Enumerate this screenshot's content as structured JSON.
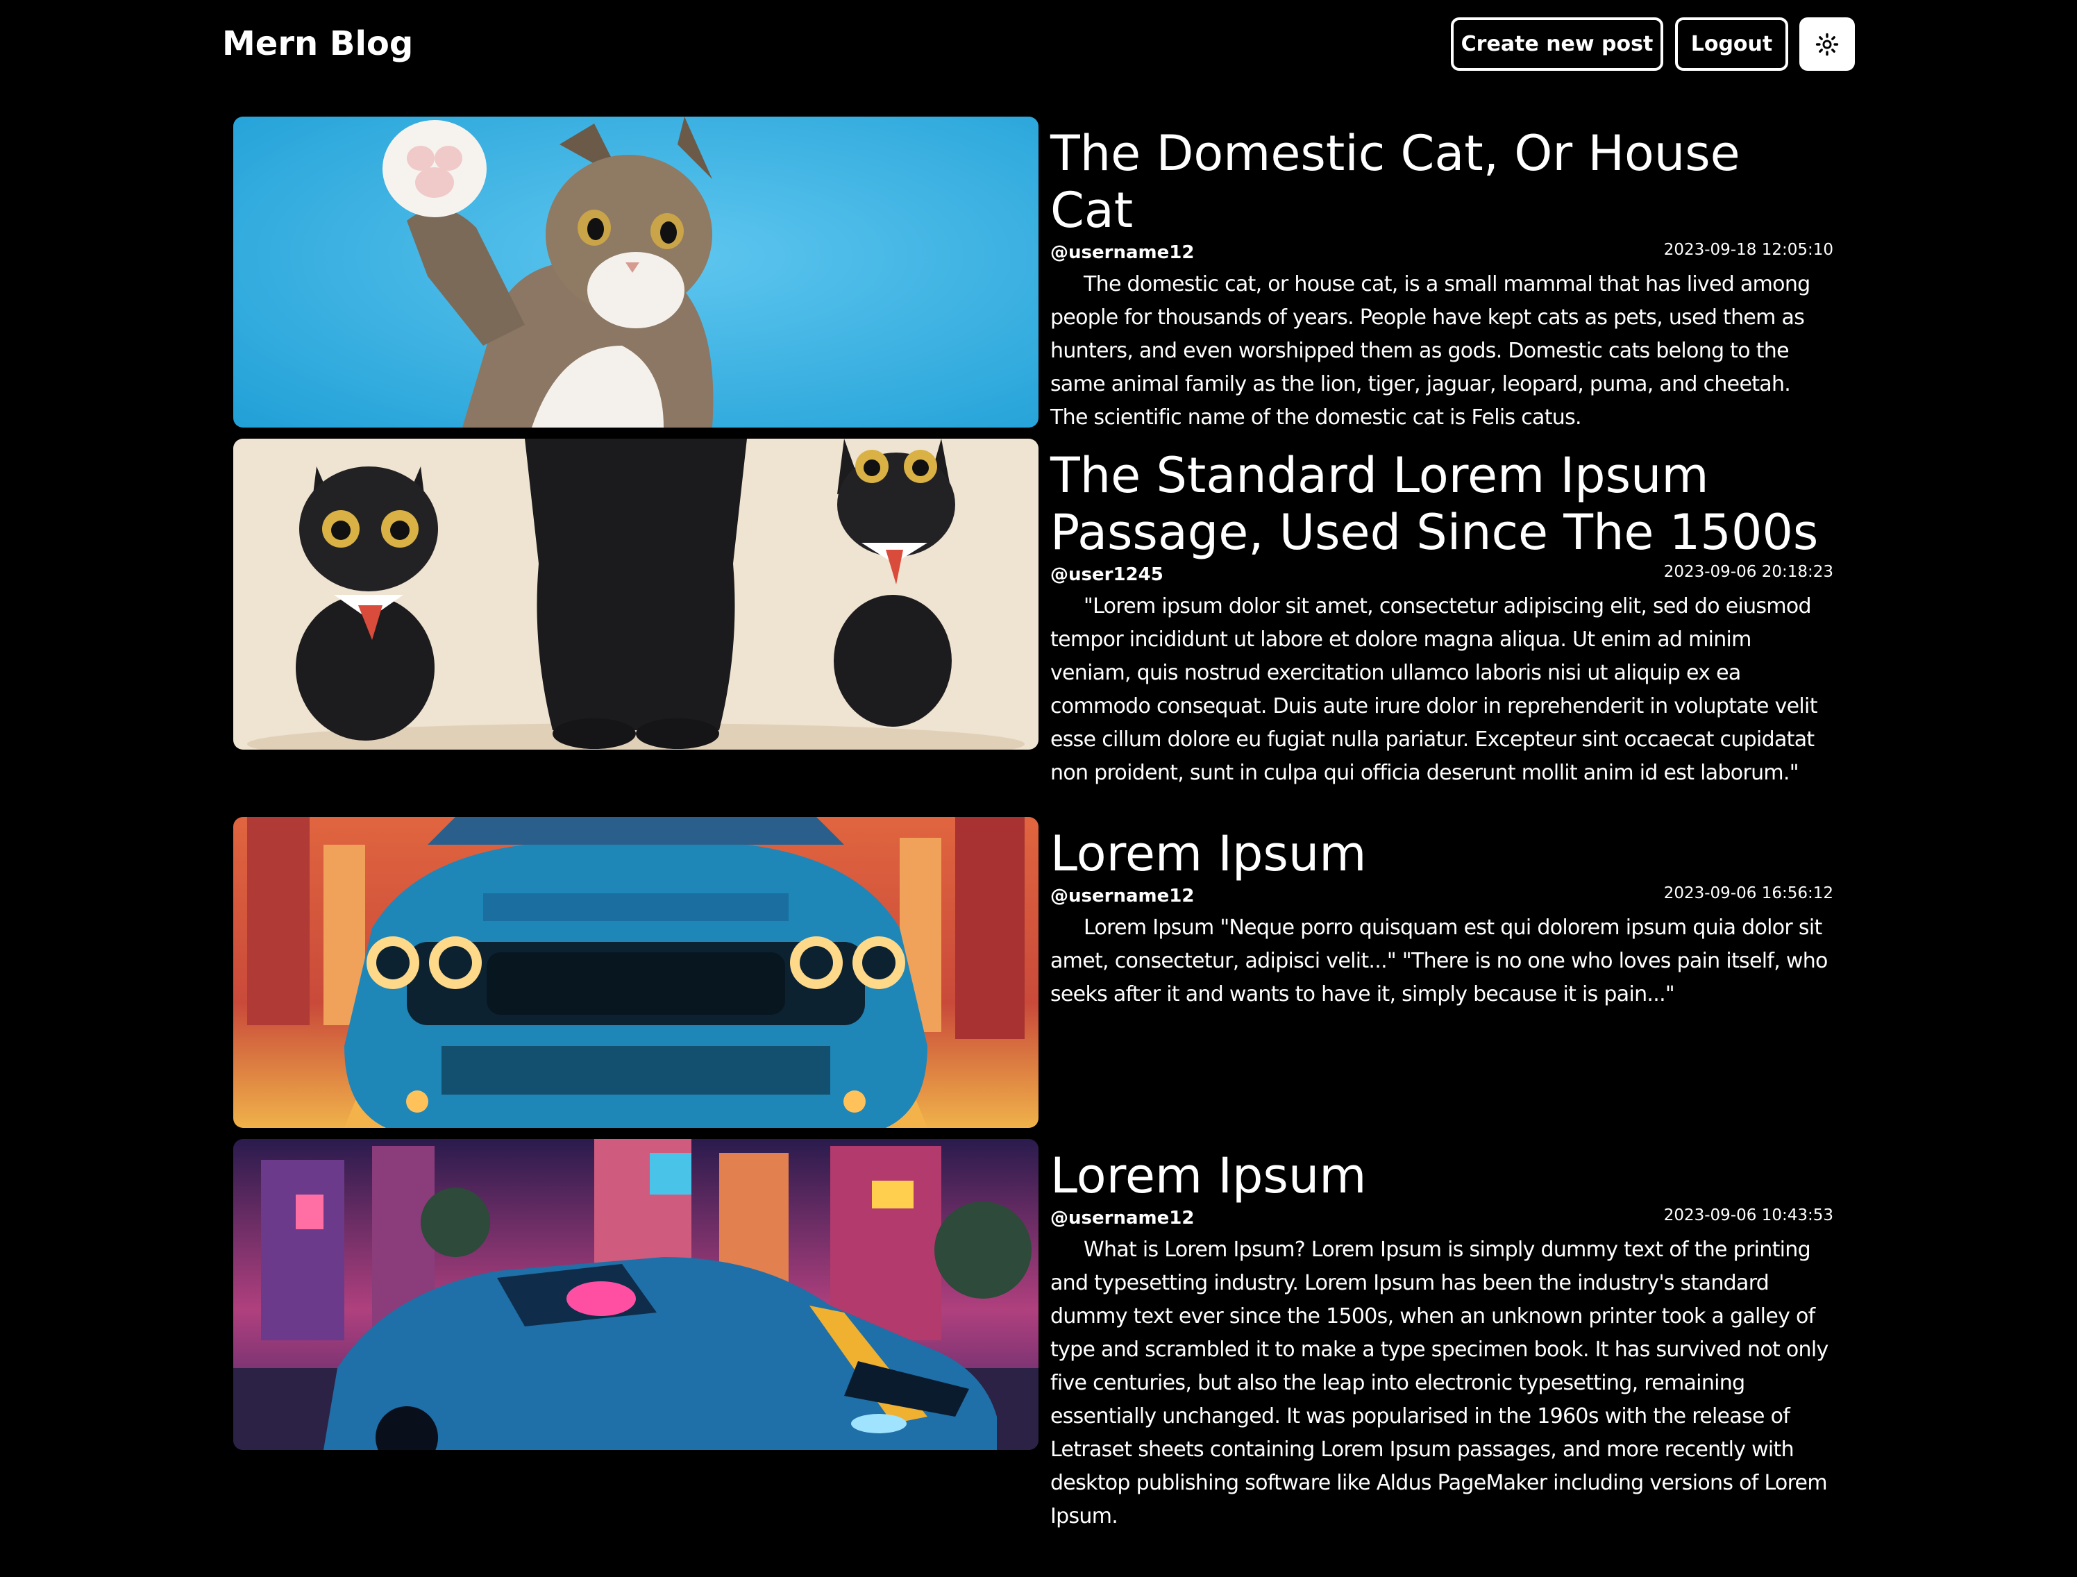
{
  "header": {
    "brand": "Mern Blog",
    "create_label": "Create new post",
    "logout_label": "Logout",
    "theme_icon": "sun-icon"
  },
  "posts": [
    {
      "title": "The Domestic Cat, Or House Cat",
      "author": "@username12",
      "time": "2023-09-18 12:05:10",
      "summary": "The domestic cat, or house cat, is a small mammal that has lived among people for thousands of years. People have kept cats as pets, used them as hunters, and even worshipped them as gods. Domestic cats belong to the same animal family as the lion, tiger, jaguar, leopard, puma, and cheetah. The scientific name of the domestic cat is Felis catus."
    },
    {
      "title": "The Standard Lorem Ipsum Passage, Used Since The 1500s",
      "author": "@user1245",
      "time": "2023-09-06 20:18:23",
      "summary": "\"Lorem ipsum dolor sit amet, consectetur adipiscing elit, sed do eiusmod tempor incididunt ut labore et dolore magna aliqua. Ut enim ad minim veniam, quis nostrud exercitation ullamco laboris nisi ut aliquip ex ea commodo consequat. Duis aute irure dolor in reprehenderit in voluptate velit esse cillum dolore eu fugiat nulla pariatur. Excepteur sint occaecat cupidatat non proident, sunt in culpa qui officia deserunt mollit anim id est laborum.\""
    },
    {
      "title": "Lorem Ipsum",
      "author": "@username12",
      "time": "2023-09-06 16:56:12",
      "summary": "Lorem Ipsum \"Neque porro quisquam est qui dolorem ipsum quia dolor sit amet, consectetur, adipisci velit...\" \"There is no one who loves pain itself, who seeks after it and wants to have it, simply because it is pain...\""
    },
    {
      "title": "Lorem Ipsum",
      "author": "@username12",
      "time": "2023-09-06 10:43:53",
      "summary": "What is Lorem Ipsum? Lorem Ipsum is simply dummy text of the printing and typesetting industry. Lorem Ipsum has been the industry's standard dummy text ever since the 1500s, when an unknown printer took a galley of type and scrambled it to make a type specimen book. It has survived not only five centuries, but also the leap into electronic typesetting, remaining essentially unchanged. It was popularised in the 1960s with the release of Letraset sheets containing Lorem Ipsum passages, and more recently with desktop publishing software like Aldus PageMaker including versions of Lorem Ipsum."
    }
  ],
  "colors": {
    "background": "#000000",
    "text": "#ffffff"
  }
}
